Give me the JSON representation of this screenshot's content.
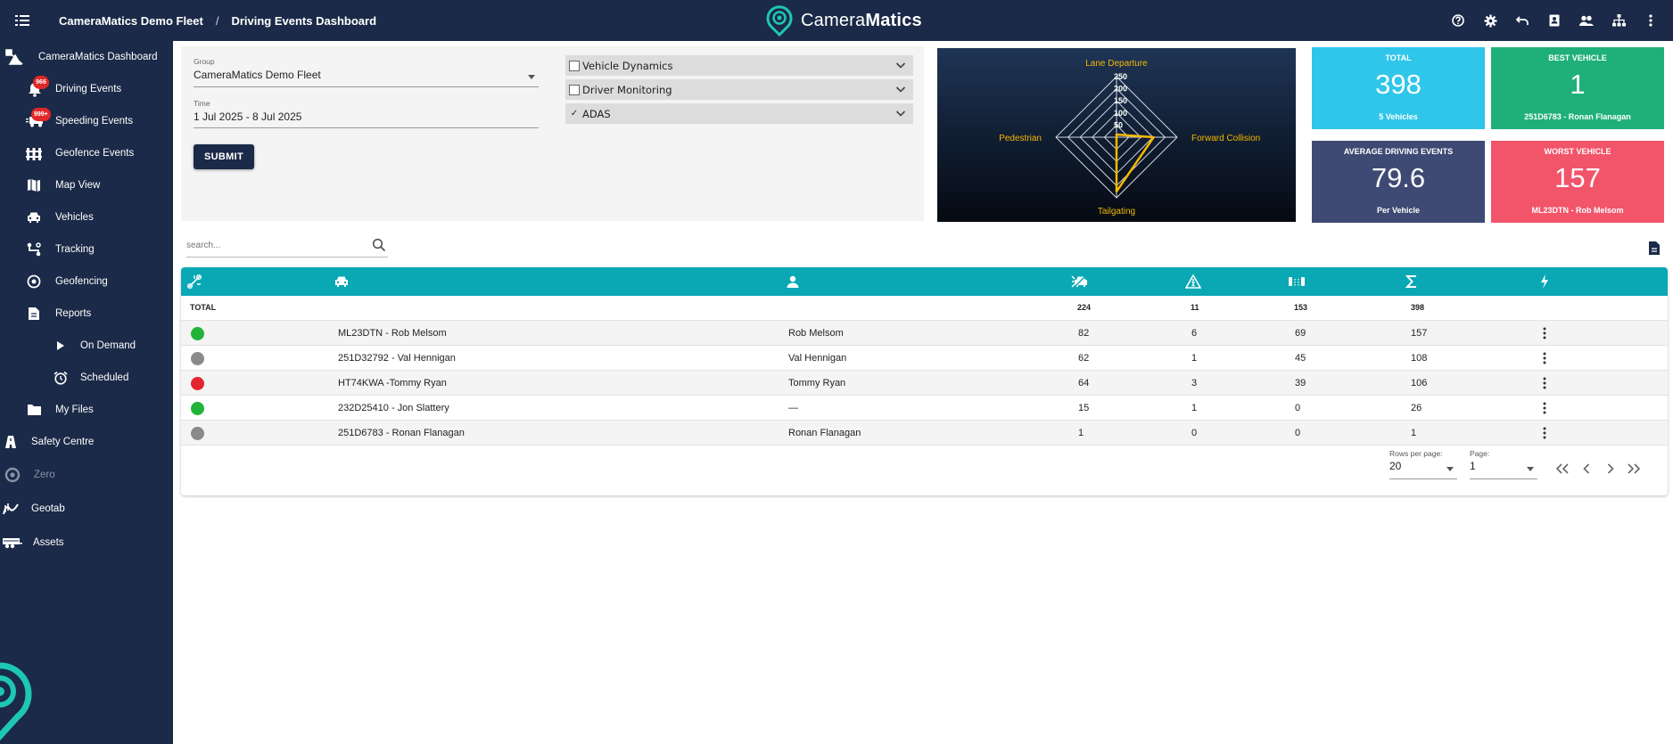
{
  "header": {
    "fleet_name": "CameraMatics Demo Fleet",
    "separator": "/",
    "page_title": "Driving Events Dashboard",
    "brand_light": "Camera",
    "brand_bold": "Matics",
    "icons": [
      "help-icon",
      "settings-icon",
      "undo-icon",
      "contacts-icon",
      "users-icon",
      "hierarchy-icon",
      "more-vert-icon"
    ]
  },
  "sidebar": {
    "items": [
      {
        "label": "CameraMatics Dashboard",
        "icon": "dashboard-icon"
      },
      {
        "label": "Driving Events",
        "icon": "bell-icon",
        "badge": "966"
      },
      {
        "label": "Speeding Events",
        "icon": "speeding-truck-icon",
        "badge": "999+"
      },
      {
        "label": "Geofence Events",
        "icon": "fence-icon"
      },
      {
        "label": "Map View",
        "icon": "map-icon"
      },
      {
        "label": "Vehicles",
        "icon": "car-icon"
      },
      {
        "label": "Tracking",
        "icon": "route-icon"
      },
      {
        "label": "Geofencing",
        "icon": "location-target-icon"
      },
      {
        "label": "Reports",
        "icon": "document-icon"
      },
      {
        "label": "On Demand",
        "icon": "play-icon"
      },
      {
        "label": "Scheduled",
        "icon": "alarm-clock-icon"
      },
      {
        "label": "My Files",
        "icon": "folder-icon"
      },
      {
        "label": "Safety Centre",
        "icon": "road-icon"
      },
      {
        "label": "Zero",
        "icon": "zero-icon"
      },
      {
        "label": "Geotab",
        "icon": "geotab-icon"
      },
      {
        "label": "Assets",
        "icon": "trailer-icon"
      }
    ]
  },
  "filters": {
    "group_label": "Group",
    "group_value": "CameraMatics Demo Fleet",
    "time_label": "Time",
    "time_value": "1 Jul 2025 - 8 Jul 2025",
    "submit_label": "SUBMIT",
    "categories": [
      {
        "label": "Vehicle Dynamics",
        "checked": false,
        "mark": ""
      },
      {
        "label": "Driver Monitoring",
        "checked": false,
        "mark": ""
      },
      {
        "label": "ADAS",
        "checked": true,
        "mark": "✓"
      }
    ]
  },
  "chart_data": {
    "type": "radar",
    "axes": [
      "Lane Departure",
      "Forward Collision",
      "Tailgating",
      "Pedestrian"
    ],
    "ticks": [
      250,
      200,
      150,
      100,
      50
    ],
    "rmax": 250,
    "values": [
      11,
      153,
      224,
      0
    ],
    "color": "#f5b800"
  },
  "cards": {
    "total": {
      "title": "TOTAL",
      "value": "398",
      "sub": "5 Vehicles",
      "color": "#2fc6ea"
    },
    "best": {
      "title": "BEST VEHICLE",
      "value": "1",
      "sub": "251D6783 - Ronan Flanagan",
      "color": "#1fb07a"
    },
    "average": {
      "title": "AVERAGE DRIVING EVENTS",
      "value": "79.6",
      "sub": "Per Vehicle",
      "color": "#3e4a73"
    },
    "worst": {
      "title": "WORST VEHICLE",
      "value": "157",
      "sub": "ML23DTN - Rob Melsom",
      "color": "#f2546a"
    }
  },
  "search": {
    "placeholder": "search..."
  },
  "table": {
    "header_icons": [
      "tracking-status-icon",
      "vehicle-icon",
      "driver-icon",
      "forward-collision-icon",
      "pedestrian-warning-icon",
      "lane-departure-icon",
      "sum-icon",
      "events-bolt-icon"
    ],
    "total": {
      "label": "TOTAL",
      "fc": "224",
      "ped": "11",
      "lane": "153",
      "sum": "398"
    },
    "rows": [
      {
        "status": "#22b33a",
        "vehicle": "ML23DTN - Rob Melsom",
        "driver": "Rob Melsom",
        "fc": "82",
        "ped": "6",
        "lane": "69",
        "sum": "157"
      },
      {
        "status": "#8a8a8a",
        "vehicle": "251D32792 - Val Hennigan",
        "driver": "Val Hennigan",
        "fc": "62",
        "ped": "1",
        "lane": "45",
        "sum": "108"
      },
      {
        "status": "#e3262d",
        "vehicle": "HT74KWA -Tommy Ryan",
        "driver": "Tommy Ryan",
        "fc": "64",
        "ped": "3",
        "lane": "39",
        "sum": "106"
      },
      {
        "status": "#22b33a",
        "vehicle": "232D25410 - Jon Slattery",
        "driver": "—",
        "fc": "15",
        "ped": "1",
        "lane": "0",
        "sum": "26"
      },
      {
        "status": "#8a8a8a",
        "vehicle": "251D6783 - Ronan Flanagan",
        "driver": "Ronan Flanagan",
        "fc": "1",
        "ped": "0",
        "lane": "0",
        "sum": "1"
      }
    ]
  },
  "pagination": {
    "rows_label": "Rows per page:",
    "rows_value": "20",
    "page_label": "Page:",
    "page_value": "1"
  }
}
